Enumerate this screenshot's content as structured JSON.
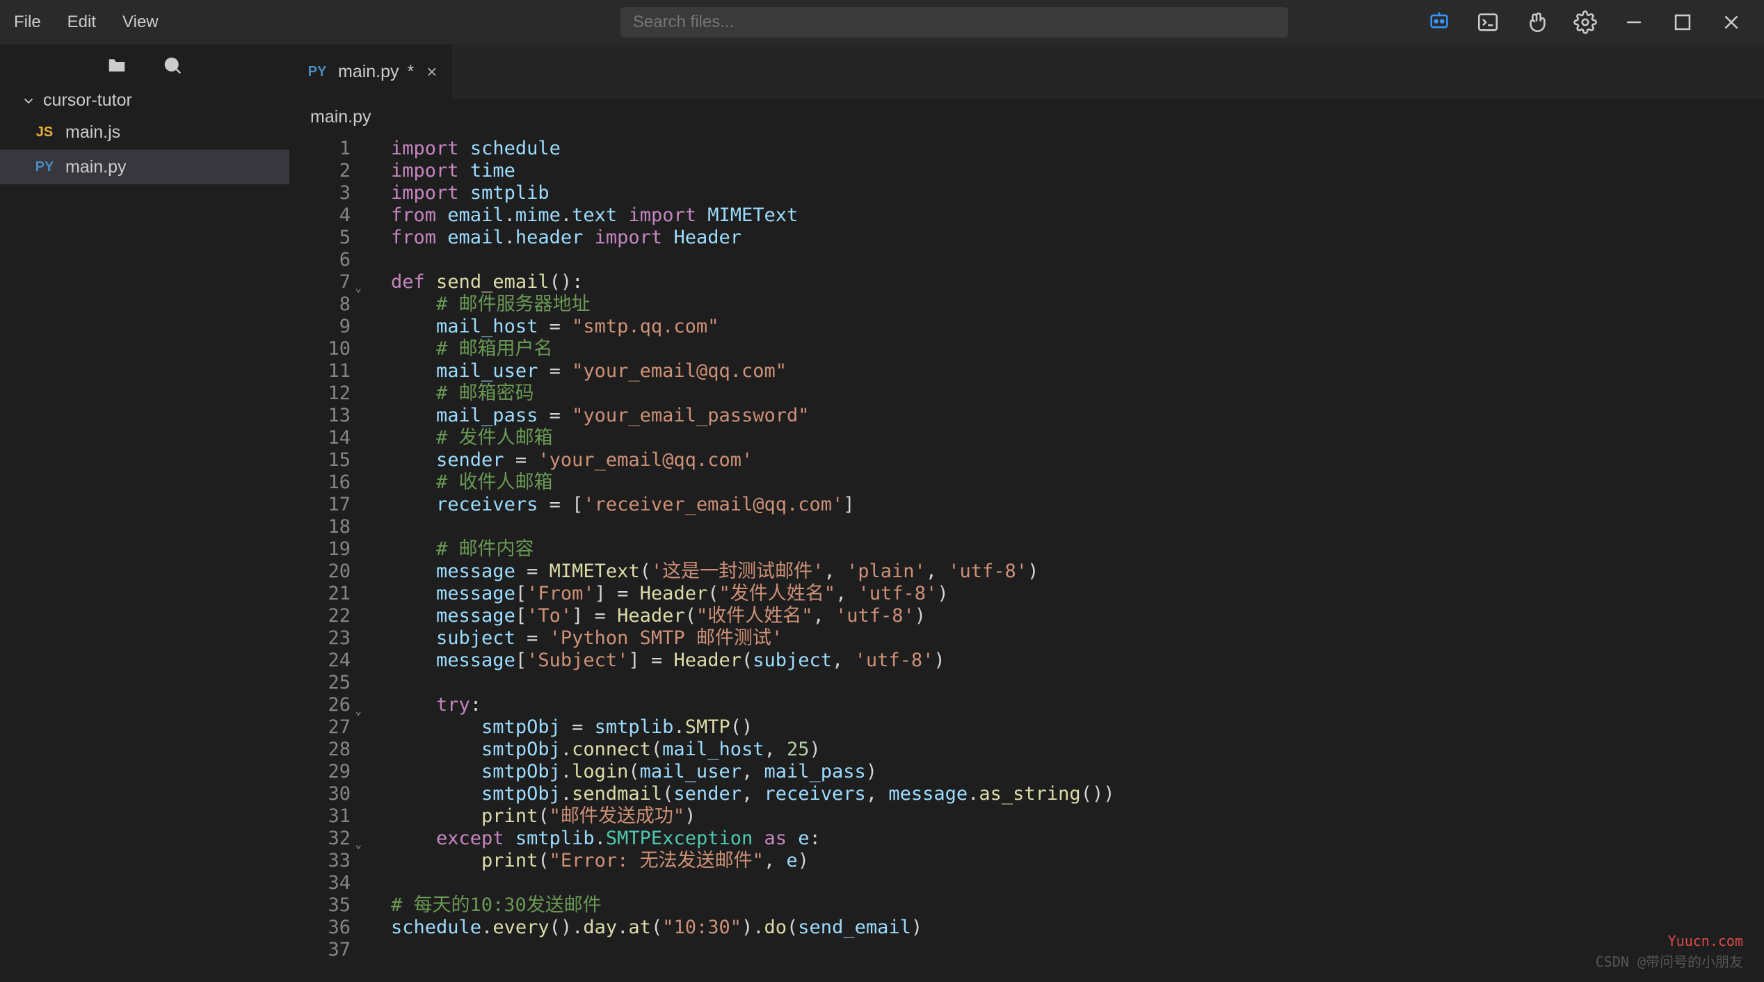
{
  "menu": {
    "file": "File",
    "edit": "Edit",
    "view": "View"
  },
  "search": {
    "placeholder": "Search files..."
  },
  "project": {
    "name": "cursor-tutor"
  },
  "files": [
    {
      "badge": "JS",
      "badge_class": "js",
      "name": "main.js",
      "active": false
    },
    {
      "badge": "PY",
      "badge_class": "py",
      "name": "main.py",
      "active": true
    }
  ],
  "tab": {
    "badge": "PY",
    "name": "main.py",
    "dirty": "*"
  },
  "breadcrumb": "main.py",
  "code_lines": [
    [
      [
        "kw",
        "import"
      ],
      [
        "pu",
        " "
      ],
      [
        "id",
        "schedule"
      ]
    ],
    [
      [
        "kw",
        "import"
      ],
      [
        "pu",
        " "
      ],
      [
        "id",
        "time"
      ]
    ],
    [
      [
        "kw",
        "import"
      ],
      [
        "pu",
        " "
      ],
      [
        "id",
        "smtplib"
      ]
    ],
    [
      [
        "kw",
        "from"
      ],
      [
        "pu",
        " "
      ],
      [
        "id",
        "email"
      ],
      [
        "pu",
        "."
      ],
      [
        "id",
        "mime"
      ],
      [
        "pu",
        "."
      ],
      [
        "id",
        "text"
      ],
      [
        "pu",
        " "
      ],
      [
        "kw",
        "import"
      ],
      [
        "pu",
        " "
      ],
      [
        "id",
        "MIMEText"
      ]
    ],
    [
      [
        "kw",
        "from"
      ],
      [
        "pu",
        " "
      ],
      [
        "id",
        "email"
      ],
      [
        "pu",
        "."
      ],
      [
        "id",
        "header"
      ],
      [
        "pu",
        " "
      ],
      [
        "kw",
        "import"
      ],
      [
        "pu",
        " "
      ],
      [
        "id",
        "Header"
      ]
    ],
    [],
    [
      [
        "kw",
        "def"
      ],
      [
        "pu",
        " "
      ],
      [
        "fn",
        "send_email"
      ],
      [
        "pu",
        "():"
      ]
    ],
    [
      [
        "pu",
        "    "
      ],
      [
        "cm",
        "# 邮件服务器地址"
      ]
    ],
    [
      [
        "pu",
        "    "
      ],
      [
        "id",
        "mail_host"
      ],
      [
        "pu",
        " = "
      ],
      [
        "str",
        "\"smtp.qq.com\""
      ]
    ],
    [
      [
        "pu",
        "    "
      ],
      [
        "cm",
        "# 邮箱用户名"
      ]
    ],
    [
      [
        "pu",
        "    "
      ],
      [
        "id",
        "mail_user"
      ],
      [
        "pu",
        " = "
      ],
      [
        "str",
        "\"your_email@qq.com\""
      ]
    ],
    [
      [
        "pu",
        "    "
      ],
      [
        "cm",
        "# 邮箱密码"
      ]
    ],
    [
      [
        "pu",
        "    "
      ],
      [
        "id",
        "mail_pass"
      ],
      [
        "pu",
        " = "
      ],
      [
        "str",
        "\"your_email_password\""
      ]
    ],
    [
      [
        "pu",
        "    "
      ],
      [
        "cm",
        "# 发件人邮箱"
      ]
    ],
    [
      [
        "pu",
        "    "
      ],
      [
        "id",
        "sender"
      ],
      [
        "pu",
        " = "
      ],
      [
        "str",
        "'your_email@qq.com'"
      ]
    ],
    [
      [
        "pu",
        "    "
      ],
      [
        "cm",
        "# 收件人邮箱"
      ]
    ],
    [
      [
        "pu",
        "    "
      ],
      [
        "id",
        "receivers"
      ],
      [
        "pu",
        " = ["
      ],
      [
        "str",
        "'receiver_email@qq.com'"
      ],
      [
        "pu",
        "]"
      ]
    ],
    [],
    [
      [
        "pu",
        "    "
      ],
      [
        "cm",
        "# 邮件内容"
      ]
    ],
    [
      [
        "pu",
        "    "
      ],
      [
        "id",
        "message"
      ],
      [
        "pu",
        " = "
      ],
      [
        "fn",
        "MIMEText"
      ],
      [
        "pu",
        "("
      ],
      [
        "str",
        "'这是一封测试邮件'"
      ],
      [
        "pu",
        ", "
      ],
      [
        "str",
        "'plain'"
      ],
      [
        "pu",
        ", "
      ],
      [
        "str",
        "'utf-8'"
      ],
      [
        "pu",
        ")"
      ]
    ],
    [
      [
        "pu",
        "    "
      ],
      [
        "id",
        "message"
      ],
      [
        "pu",
        "["
      ],
      [
        "str",
        "'From'"
      ],
      [
        "pu",
        "] = "
      ],
      [
        "fn",
        "Header"
      ],
      [
        "pu",
        "("
      ],
      [
        "str",
        "\"发件人姓名\""
      ],
      [
        "pu",
        ", "
      ],
      [
        "str",
        "'utf-8'"
      ],
      [
        "pu",
        ")"
      ]
    ],
    [
      [
        "pu",
        "    "
      ],
      [
        "id",
        "message"
      ],
      [
        "pu",
        "["
      ],
      [
        "str",
        "'To'"
      ],
      [
        "pu",
        "] = "
      ],
      [
        "fn",
        "Header"
      ],
      [
        "pu",
        "("
      ],
      [
        "str",
        "\"收件人姓名\""
      ],
      [
        "pu",
        ", "
      ],
      [
        "str",
        "'utf-8'"
      ],
      [
        "pu",
        ")"
      ]
    ],
    [
      [
        "pu",
        "    "
      ],
      [
        "id",
        "subject"
      ],
      [
        "pu",
        " = "
      ],
      [
        "str",
        "'Python SMTP 邮件测试'"
      ]
    ],
    [
      [
        "pu",
        "    "
      ],
      [
        "id",
        "message"
      ],
      [
        "pu",
        "["
      ],
      [
        "str",
        "'Subject'"
      ],
      [
        "pu",
        "] = "
      ],
      [
        "fn",
        "Header"
      ],
      [
        "pu",
        "("
      ],
      [
        "id",
        "subject"
      ],
      [
        "pu",
        ", "
      ],
      [
        "str",
        "'utf-8'"
      ],
      [
        "pu",
        ")"
      ]
    ],
    [],
    [
      [
        "pu",
        "    "
      ],
      [
        "kw",
        "try"
      ],
      [
        "pu",
        ":"
      ]
    ],
    [
      [
        "pu",
        "        "
      ],
      [
        "id",
        "smtpObj"
      ],
      [
        "pu",
        " = "
      ],
      [
        "id",
        "smtplib"
      ],
      [
        "pu",
        "."
      ],
      [
        "fn",
        "SMTP"
      ],
      [
        "pu",
        "()"
      ]
    ],
    [
      [
        "pu",
        "        "
      ],
      [
        "id",
        "smtpObj"
      ],
      [
        "pu",
        "."
      ],
      [
        "fn",
        "connect"
      ],
      [
        "pu",
        "("
      ],
      [
        "id",
        "mail_host"
      ],
      [
        "pu",
        ", "
      ],
      [
        "num",
        "25"
      ],
      [
        "pu",
        ")"
      ]
    ],
    [
      [
        "pu",
        "        "
      ],
      [
        "id",
        "smtpObj"
      ],
      [
        "pu",
        "."
      ],
      [
        "fn",
        "login"
      ],
      [
        "pu",
        "("
      ],
      [
        "id",
        "mail_user"
      ],
      [
        "pu",
        ", "
      ],
      [
        "id",
        "mail_pass"
      ],
      [
        "pu",
        ")"
      ]
    ],
    [
      [
        "pu",
        "        "
      ],
      [
        "id",
        "smtpObj"
      ],
      [
        "pu",
        "."
      ],
      [
        "fn",
        "sendmail"
      ],
      [
        "pu",
        "("
      ],
      [
        "id",
        "sender"
      ],
      [
        "pu",
        ", "
      ],
      [
        "id",
        "receivers"
      ],
      [
        "pu",
        ", "
      ],
      [
        "id",
        "message"
      ],
      [
        "pu",
        "."
      ],
      [
        "fn",
        "as_string"
      ],
      [
        "pu",
        "())"
      ]
    ],
    [
      [
        "pu",
        "        "
      ],
      [
        "fn",
        "print"
      ],
      [
        "pu",
        "("
      ],
      [
        "str",
        "\"邮件发送成功\""
      ],
      [
        "pu",
        ")"
      ]
    ],
    [
      [
        "pu",
        "    "
      ],
      [
        "kw",
        "except"
      ],
      [
        "pu",
        " "
      ],
      [
        "id",
        "smtplib"
      ],
      [
        "pu",
        "."
      ],
      [
        "cls",
        "SMTPException"
      ],
      [
        "pu",
        " "
      ],
      [
        "kw",
        "as"
      ],
      [
        "pu",
        " "
      ],
      [
        "id",
        "e"
      ],
      [
        "pu",
        ":"
      ]
    ],
    [
      [
        "pu",
        "        "
      ],
      [
        "fn",
        "print"
      ],
      [
        "pu",
        "("
      ],
      [
        "str",
        "\"Error: 无法发送邮件\""
      ],
      [
        "pu",
        ", "
      ],
      [
        "id",
        "e"
      ],
      [
        "pu",
        ")"
      ]
    ],
    [],
    [
      [
        "cm",
        "# 每天的10:30发送邮件"
      ]
    ],
    [
      [
        "id",
        "schedule"
      ],
      [
        "pu",
        "."
      ],
      [
        "fn",
        "every"
      ],
      [
        "pu",
        "()."
      ],
      [
        "fn",
        "day"
      ],
      [
        "pu",
        "."
      ],
      [
        "fn",
        "at"
      ],
      [
        "pu",
        "("
      ],
      [
        "str",
        "\"10:30\""
      ],
      [
        "pu",
        ")."
      ],
      [
        "fn",
        "do"
      ],
      [
        "pu",
        "("
      ],
      [
        "id",
        "send_email"
      ],
      [
        "pu",
        ")"
      ]
    ],
    []
  ],
  "fold_lines": [
    7,
    26,
    32
  ],
  "watermarks": {
    "main": "CSDN @带问号的小朋友",
    "red": "Yuucn.com"
  }
}
